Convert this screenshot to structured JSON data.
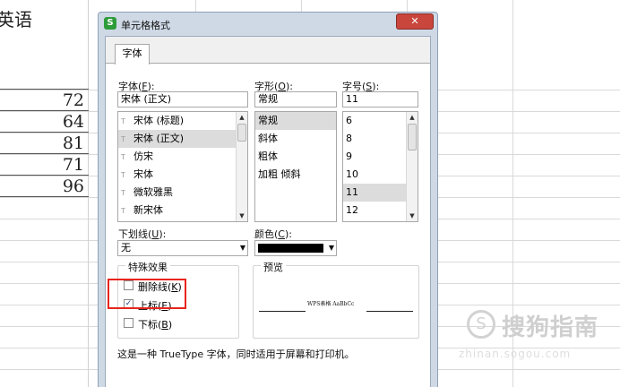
{
  "sheet": {
    "header_text": "英语",
    "values": [
      "72",
      "64",
      "81",
      "71",
      "96"
    ]
  },
  "watermark": {
    "symbol": "S",
    "text": "搜狗指南",
    "sub": "zhinan.sogou.com"
  },
  "dialog": {
    "icon_letter": "S",
    "title": "单元格格式",
    "close_glyph": "✕",
    "tab": "字体",
    "font_label": "字体(",
    "font_key": "F",
    "font_value": "宋体 (正文)",
    "font_list": [
      {
        "label": "宋体 (标题)",
        "selected": false
      },
      {
        "label": "宋体 (正文)",
        "selected": true
      },
      {
        "label": "仿宋",
        "selected": false
      },
      {
        "label": "宋体",
        "selected": false
      },
      {
        "label": "微软雅黑",
        "selected": false
      },
      {
        "label": "新宋体",
        "selected": false
      }
    ],
    "style_label": "字形(",
    "style_key": "O",
    "style_value": "常规",
    "style_list": [
      {
        "label": "常规",
        "selected": true
      },
      {
        "label": "斜体",
        "selected": false
      },
      {
        "label": "粗体",
        "selected": false
      },
      {
        "label": "加粗 倾斜",
        "selected": false
      }
    ],
    "size_label": "字号(",
    "size_key": "S",
    "size_value": "11",
    "size_list": [
      {
        "label": "6",
        "selected": false
      },
      {
        "label": "8",
        "selected": false
      },
      {
        "label": "9",
        "selected": false
      },
      {
        "label": "10",
        "selected": false
      },
      {
        "label": "11",
        "selected": true
      },
      {
        "label": "12",
        "selected": false
      }
    ],
    "underline_label": "下划线(",
    "underline_key": "U",
    "underline_value": "无",
    "color_label": "颜色(",
    "color_key": "C",
    "color_value": "#000000",
    "effects_title": "特殊效果",
    "strike_label": "删除线(",
    "strike_key": "K",
    "strike_checked": false,
    "superscript_label": "上标(",
    "superscript_key": "E",
    "superscript_checked": true,
    "subscript_label": "下标(",
    "subscript_key": "B",
    "subscript_checked": false,
    "preview_title": "预览",
    "preview_text": "WPS表格 AaBbCc",
    "note": "这是一种 TrueType 字体，同时适用于屏幕和打印机。"
  }
}
